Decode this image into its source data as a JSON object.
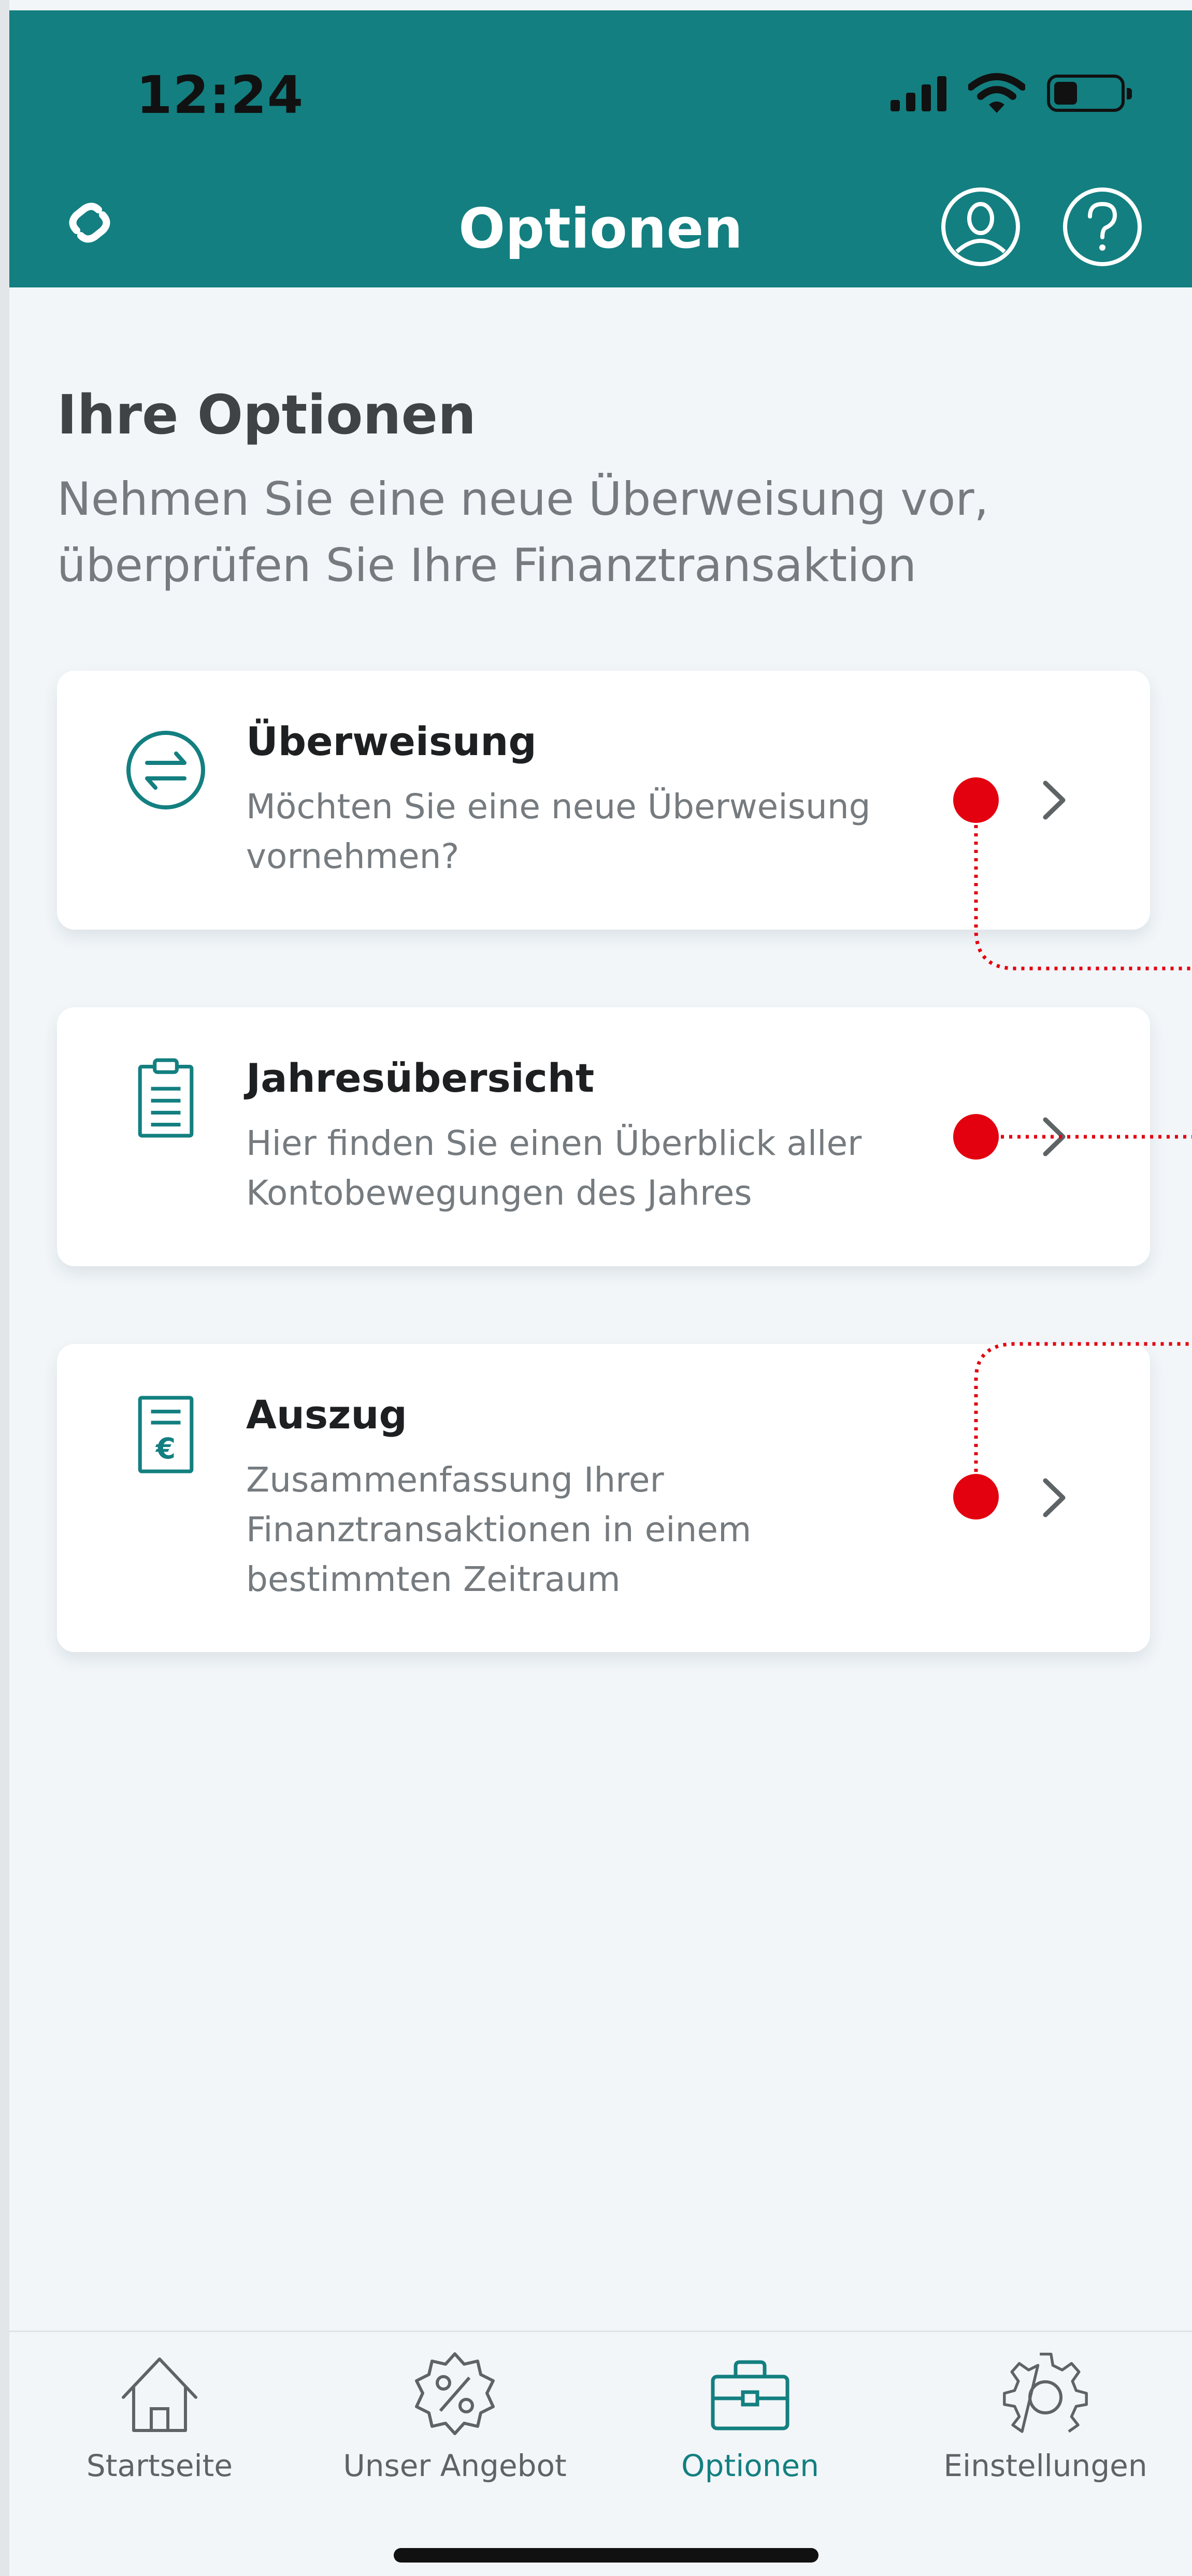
{
  "status": {
    "time": "12:24"
  },
  "header": {
    "title": "Optionen"
  },
  "intro": {
    "title": "Ihre Optionen",
    "subtitle": "Nehmen Sie eine neue Überweisung vor, überprüfen Sie Ihre Finanztransaktion"
  },
  "options": [
    {
      "title": "Überweisung",
      "description": "Möchten Sie eine neue Überweisung vornehmen?",
      "icon": "transfer-arrows-icon"
    },
    {
      "title": "Jahresübersicht",
      "description": "Hier finden Sie einen Überblick aller Kontobewegungen des Jahres",
      "icon": "clipboard-list-icon"
    },
    {
      "title": "Auszug",
      "description": "Zusammenfassung Ihrer Finanztransaktionen in einem bestimmten Zeitraum",
      "icon": "euro-document-icon"
    }
  ],
  "tabs": [
    {
      "label": "Startseite",
      "icon": "home-icon"
    },
    {
      "label": "Unser Angebot",
      "icon": "percent-badge-icon"
    },
    {
      "label": "Optionen",
      "icon": "briefcase-icon",
      "active": true
    },
    {
      "label": "Einstellungen",
      "icon": "gear-icon"
    }
  ],
  "colors": {
    "brand": "#137f80",
    "annotation": "#e3000f",
    "background": "#f2f6f9"
  }
}
